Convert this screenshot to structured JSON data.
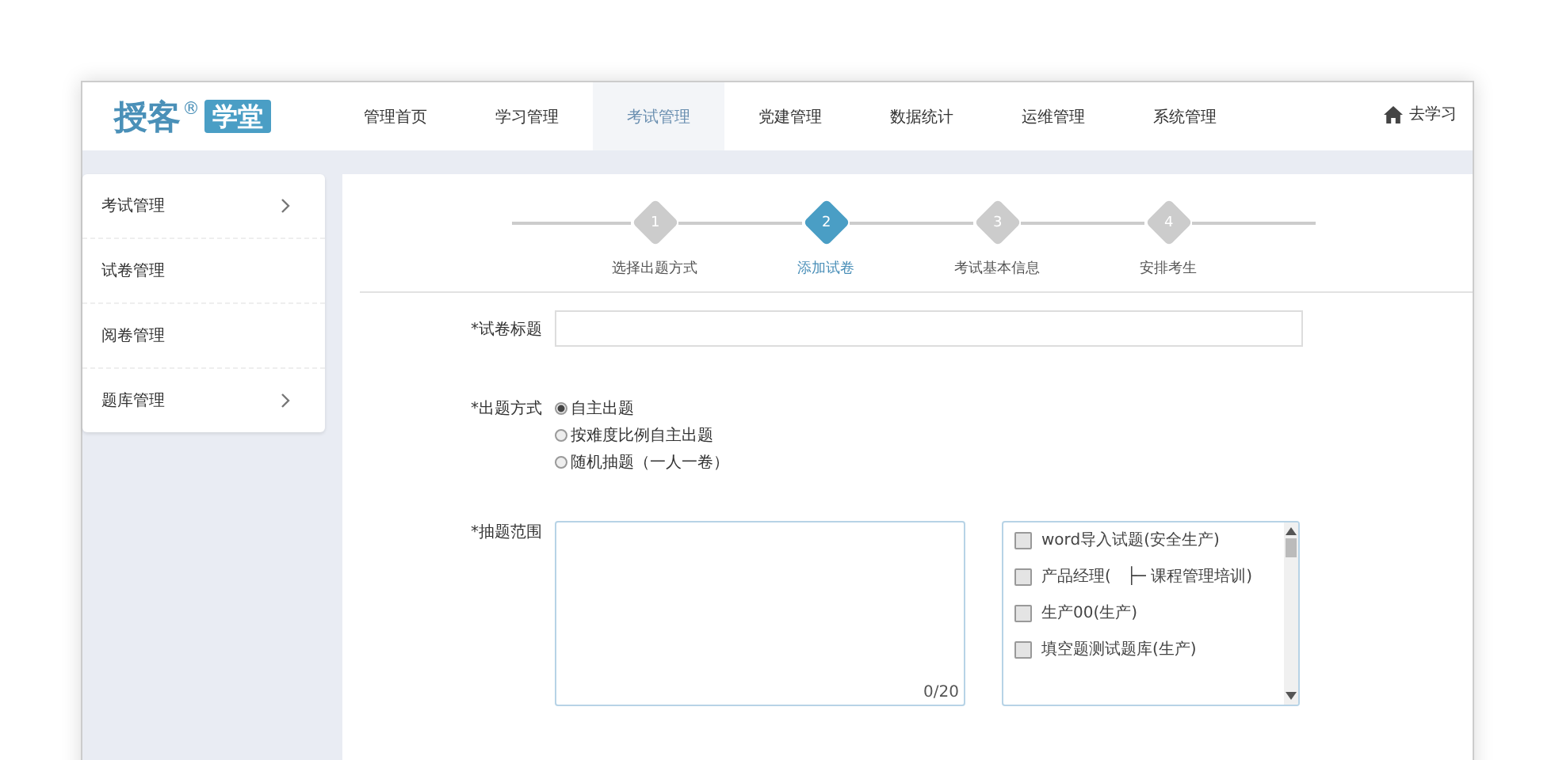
{
  "logo": {
    "text": "授客",
    "mark": "®",
    "badge": "学堂"
  },
  "nav": [
    {
      "label": "管理首页",
      "selected": false
    },
    {
      "label": "学习管理",
      "selected": false
    },
    {
      "label": "考试管理",
      "selected": true
    },
    {
      "label": "党建管理",
      "selected": false
    },
    {
      "label": "数据统计",
      "selected": false
    },
    {
      "label": "运维管理",
      "selected": false
    },
    {
      "label": "系统管理",
      "selected": false
    }
  ],
  "go_study": "去学习",
  "sidebar": {
    "items": [
      {
        "label": "考试管理",
        "expandable": true
      },
      {
        "label": "试卷管理",
        "expandable": false
      },
      {
        "label": "阅卷管理",
        "expandable": false
      },
      {
        "label": "题库管理",
        "expandable": true
      }
    ]
  },
  "steps": [
    {
      "number": "1",
      "label": "选择出题方式",
      "selected": false
    },
    {
      "number": "2",
      "label": "添加试卷",
      "selected": true
    },
    {
      "number": "3",
      "label": "考试基本信息",
      "selected": false
    },
    {
      "number": "4",
      "label": "安排考生",
      "selected": false
    }
  ],
  "form": {
    "title_label": "*试卷标题",
    "mode_label": "*出题方式",
    "modes": [
      {
        "label": "自主出题",
        "selected": true
      },
      {
        "label": "按难度比例自主出题",
        "selected": false
      },
      {
        "label": "随机抽题（一人一卷）",
        "selected": false
      }
    ],
    "scope_label": "*抽题范围",
    "scope_counter": "0/20",
    "banks": [
      {
        "label": "word导入试题(安全生产)",
        "checked": false
      },
      {
        "label": "产品经理(　├─ 课程管理培训)",
        "checked": false
      },
      {
        "label": "生产00(生产)",
        "checked": false
      },
      {
        "label": "填空题测试题库(生产)",
        "checked": false
      }
    ]
  }
}
